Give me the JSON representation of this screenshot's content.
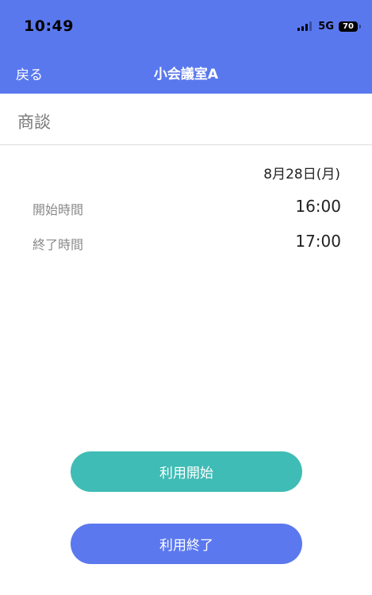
{
  "status_bar": {
    "time": "10:49",
    "network": "5G",
    "battery": "70"
  },
  "nav": {
    "back_label": "戻る",
    "title": "小会議室A"
  },
  "reservation": {
    "subject": "商談",
    "date": "8月28日(月)",
    "start_label": "開始時間",
    "start_time": "16:00",
    "end_label": "終了時間",
    "end_time": "17:00"
  },
  "buttons": {
    "start_label": "利用開始",
    "end_label": "利用終了"
  },
  "colors": {
    "header": "#5a78ee",
    "start_button": "#3fbcb5",
    "end_button": "#5b78ee"
  }
}
